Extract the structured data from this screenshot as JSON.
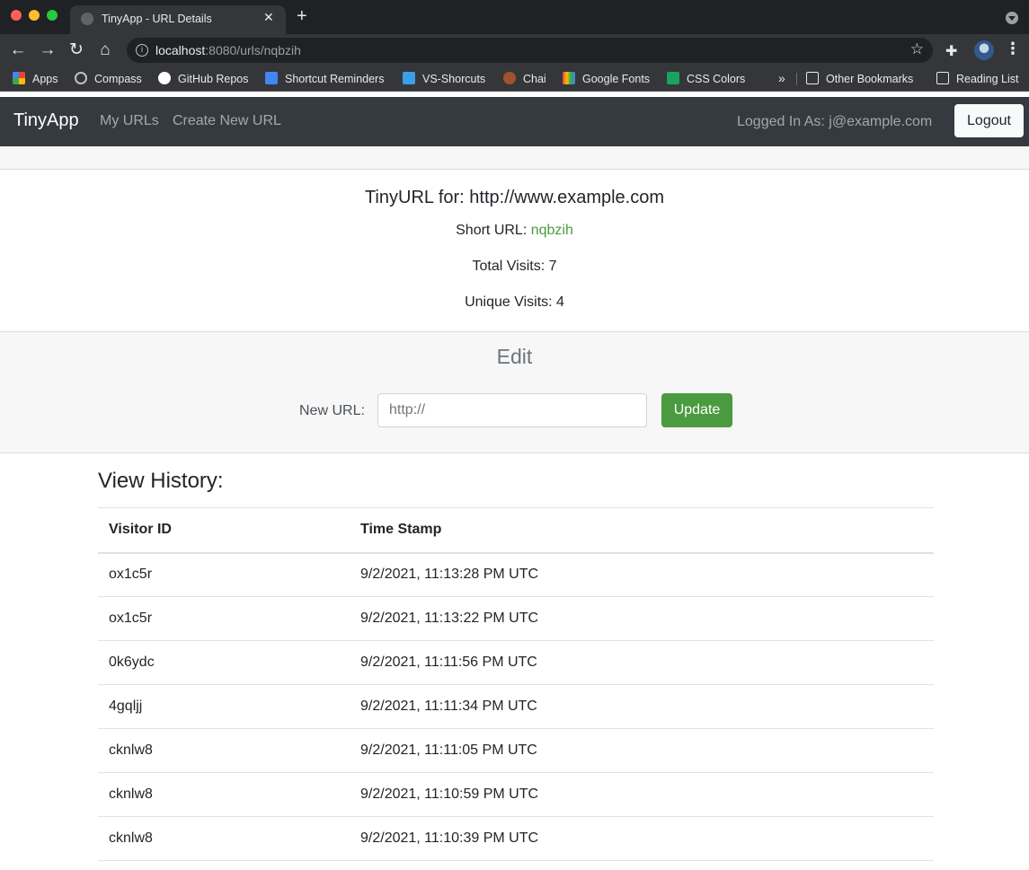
{
  "browser": {
    "tab_title": "TinyApp - URL Details",
    "url_host": "localhost",
    "url_rest": ":8080/urls/nqbzih",
    "bookmarks": [
      {
        "label": "Apps",
        "icon": "apps-grid-icon",
        "color": "#ea4335"
      },
      {
        "label": "Compass",
        "icon": "compass-icon",
        "color": "#bdc1c6"
      },
      {
        "label": "GitHub Repos",
        "icon": "github-icon",
        "color": "#ffffff"
      },
      {
        "label": "Shortcut Reminders",
        "icon": "docs-icon",
        "color": "#4285f4"
      },
      {
        "label": "VS-Shorcuts",
        "icon": "vscode-icon",
        "color": "#3b9fe8"
      },
      {
        "label": "Chai",
        "icon": "chai-icon",
        "color": "#a0522d"
      },
      {
        "label": "Google Fonts",
        "icon": "google-fonts-icon",
        "color": "#34a853"
      },
      {
        "label": "CSS Colors",
        "icon": "css-colors-icon",
        "color": "#1aa260"
      }
    ],
    "other_bookmarks": "Other Bookmarks",
    "reading_list": "Reading List"
  },
  "navbar": {
    "brand": "TinyApp",
    "links": [
      "My URLs",
      "Create New URL"
    ],
    "logged_in": "Logged In As: j@example.com",
    "logout": "Logout"
  },
  "details": {
    "title": "TinyURL for: http://www.example.com",
    "short_label": "Short URL: ",
    "short_code": "nqbzih",
    "total_visits": "Total Visits: 7",
    "unique_visits": "Unique Visits: 4"
  },
  "edit": {
    "title": "Edit",
    "label": "New URL:",
    "placeholder": "http://",
    "button": "Update"
  },
  "history": {
    "title": "View History:",
    "columns": [
      "Visitor ID",
      "Time Stamp"
    ],
    "rows": [
      {
        "id": "ox1c5r",
        "time": "9/2/2021, 11:13:28 PM UTC"
      },
      {
        "id": "ox1c5r",
        "time": "9/2/2021, 11:13:22 PM UTC"
      },
      {
        "id": "0k6ydc",
        "time": "9/2/2021, 11:11:56 PM UTC"
      },
      {
        "id": "4gqljj",
        "time": "9/2/2021, 11:11:34 PM UTC"
      },
      {
        "id": "cknlw8",
        "time": "9/2/2021, 11:11:05 PM UTC"
      },
      {
        "id": "cknlw8",
        "time": "9/2/2021, 11:10:59 PM UTC"
      },
      {
        "id": "cknlw8",
        "time": "9/2/2021, 11:10:39 PM UTC"
      }
    ]
  },
  "colors": {
    "navbar": "#343a40",
    "accent_green": "#4a9b3f"
  }
}
